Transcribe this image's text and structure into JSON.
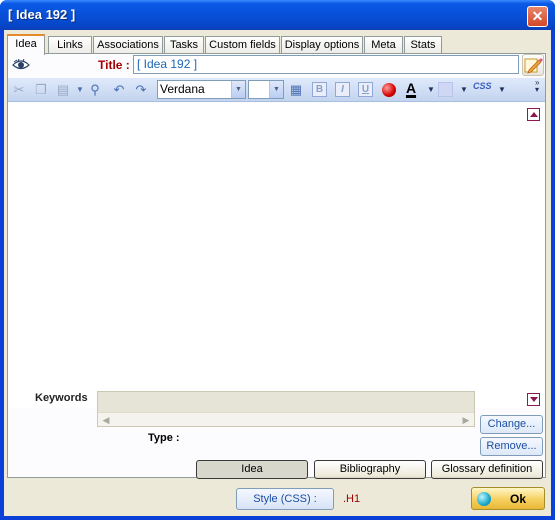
{
  "window": {
    "title": "[ Idea 192 ]"
  },
  "tabs": [
    {
      "label": "Idea"
    },
    {
      "label": "Links"
    },
    {
      "label": "Associations"
    },
    {
      "label": "Tasks"
    },
    {
      "label": "Custom fields"
    },
    {
      "label": "Display options"
    },
    {
      "label": "Meta"
    },
    {
      "label": "Stats"
    }
  ],
  "active_tab": "Idea",
  "title_row": {
    "label": "Title :",
    "value": "[ Idea 192 ]"
  },
  "toolbar": {
    "font_name": "Verdana",
    "font_size": "",
    "bold": "B",
    "italic": "I",
    "underline": "U",
    "font_color_letter": "A",
    "css_label": "CSS"
  },
  "editor": {
    "content": ""
  },
  "keywords": {
    "label": "Keywords",
    "value": "",
    "change_label": "Change...",
    "remove_label": "Remove..."
  },
  "type": {
    "label": "Type :",
    "options": [
      "Idea",
      "Bibliography",
      "Glossary definition"
    ],
    "selected": "Idea"
  },
  "footer": {
    "style_button": "Style (CSS) :",
    "style_value": ".H1",
    "ok_label": "Ok"
  },
  "colors": {
    "titlebar": "#0850d8",
    "title_label": "#a30000",
    "title_value": "#1d66b8",
    "toolbar": "#c3d4ef",
    "editor_scroll": "#8b1a52",
    "ok_button": "#f5d060"
  }
}
